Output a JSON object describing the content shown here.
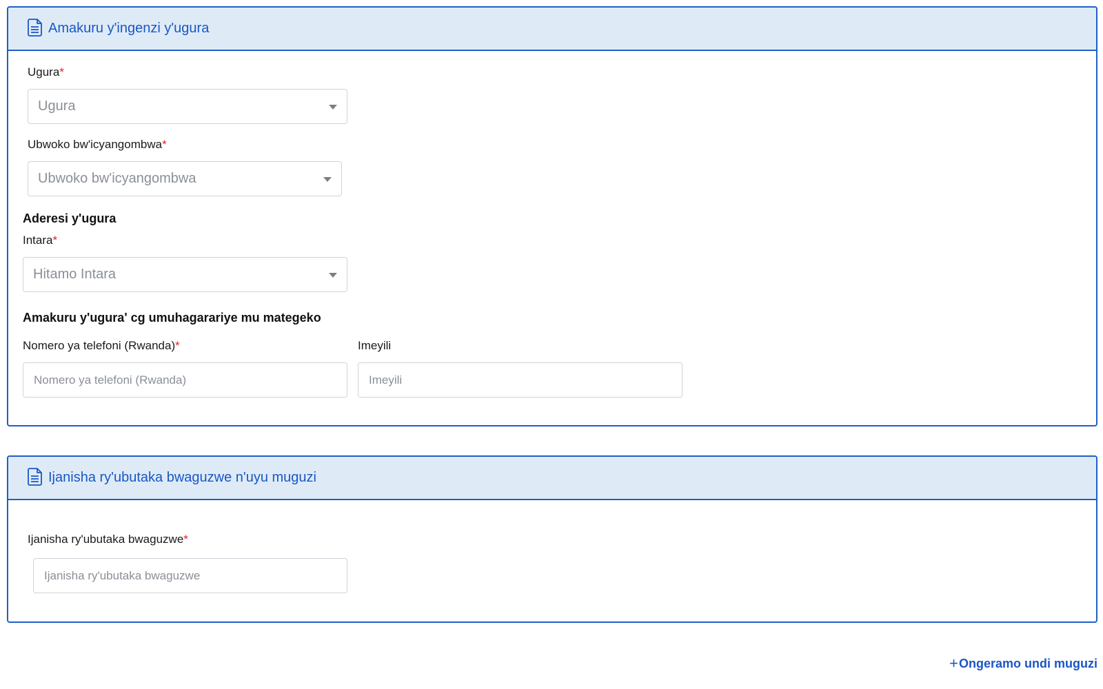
{
  "section1": {
    "title": "Amakuru y'ingenzi y'ugura",
    "ugura": {
      "label": "Ugura",
      "placeholder": "Ugura"
    },
    "ubwoko": {
      "label": "Ubwoko bw'icyangombwa",
      "placeholder": "Ubwoko bw'icyangombwa"
    },
    "address_heading": "Aderesi y'ugura",
    "intara": {
      "label": "Intara",
      "placeholder": "Hitamo Intara"
    },
    "contact_heading": "Amakuru y'ugura' cg umuhagarariye mu mategeko",
    "phone": {
      "label": "Nomero ya telefoni (Rwanda)",
      "placeholder": "Nomero ya telefoni (Rwanda)"
    },
    "email": {
      "label": "Imeyili",
      "placeholder": "Imeyili"
    }
  },
  "section2": {
    "title": "Ijanisha ry'ubutaka bwaguzwe n'uyu muguzi",
    "share": {
      "label": "Ijanisha ry'ubutaka bwaguzwe",
      "placeholder": "Ijanisha ry'ubutaka bwaguzwe"
    }
  },
  "add_buyer": {
    "plus": "+",
    "label": "Ongeramo undi muguzi"
  },
  "required_mark": "*",
  "colors": {
    "accent": "#1a56c4",
    "header_bg": "#deebf7",
    "required": "#e0202e"
  },
  "icons": {
    "section_header": "document-icon"
  }
}
